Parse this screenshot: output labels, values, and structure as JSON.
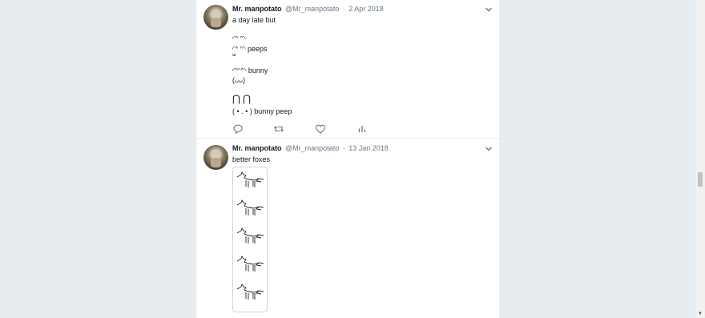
{
  "tweets": [
    {
      "name": "Mr. manpotato",
      "handle": "@Mr_manpotato",
      "date": "2 Apr 2018",
      "text": "a day late but",
      "art": [
        "◜ᐢ ᐢ◝",
        "◜ᐢ ᐢ◝ peeps",
        "ᐜ",
        "◜ᐢᵔᐢ◝ bunny",
        "(ᴗᴗ)",
        "⋂ ⋂",
        "( • . • ) bunny peep"
      ]
    },
    {
      "name": "Mr. manpotato",
      "handle": "@Mr_manpotato",
      "date": "13 Jan 2018",
      "text": "better foxes",
      "media_count": 5
    }
  ],
  "icons": [
    "reply-icon",
    "retweet-icon",
    "like-icon",
    "analytics-icon",
    "chevron-down-icon"
  ],
  "colors": {
    "background": "#e6ecf0",
    "card": "#ffffff",
    "muted": "#657786",
    "text": "#14171a",
    "accent": "#1da1f2"
  }
}
